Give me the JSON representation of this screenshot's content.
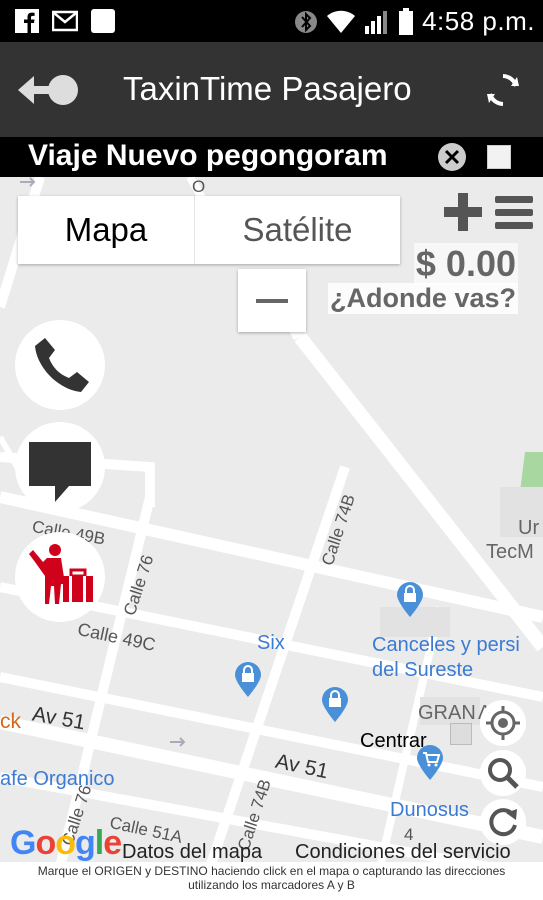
{
  "status_bar": {
    "time": "4:58 p.m.",
    "left_icons": [
      "facebook-icon",
      "mail-icon",
      "square-icon"
    ],
    "right_icons": [
      "bluetooth-icon",
      "wifi-icon",
      "signal-icon",
      "battery-icon"
    ]
  },
  "toolbar": {
    "title": "TaxinTime Pasajero"
  },
  "trip": {
    "title": "Viaje Nuevo pegongoram"
  },
  "map": {
    "type_buttons": {
      "map": "Mapa",
      "satellite": "Satélite"
    },
    "price": "$ 0.00",
    "destination_prompt": "¿Adonde vas?",
    "streets": {
      "calle_49b": "Calle 49B",
      "calle_76_top": "Calle 76",
      "calle_74b_top": "Calle 74B",
      "calle_49c": "Calle 49C",
      "av_51_left": "Av 51",
      "av_51_right": "Av 51",
      "calle_51a": "Calle 51A",
      "calle_76_bottom": "Calle 76",
      "calle_74b_bottom": "Calle 74B",
      "ck": "ck",
      "o_top": "O",
      "num_4": "4"
    },
    "pois": {
      "six": "Six",
      "canceles_1": "Canceles y persi",
      "canceles_2": "del Sureste",
      "gran": "GRAN",
      "al": "AL",
      "centrar": "Centrar",
      "cafe": "afe Organico",
      "dunosus": "Dunosus",
      "tecm_1": "Ur",
      "tecm_2": "TecM"
    },
    "attribution": {
      "google": "Google",
      "map_data": "Datos del mapa",
      "terms": "Condiciones del servicio"
    }
  },
  "footer": {
    "line1": "Marque el ORIGEN y DESTINO haciendo click en el mapa o capturando las direcciones",
    "line2": "utilizando los marcadores A y B"
  },
  "colors": {
    "toolbar": "#333333",
    "accent_red": "#d0021b",
    "poi_blue": "#3b7bd4"
  }
}
